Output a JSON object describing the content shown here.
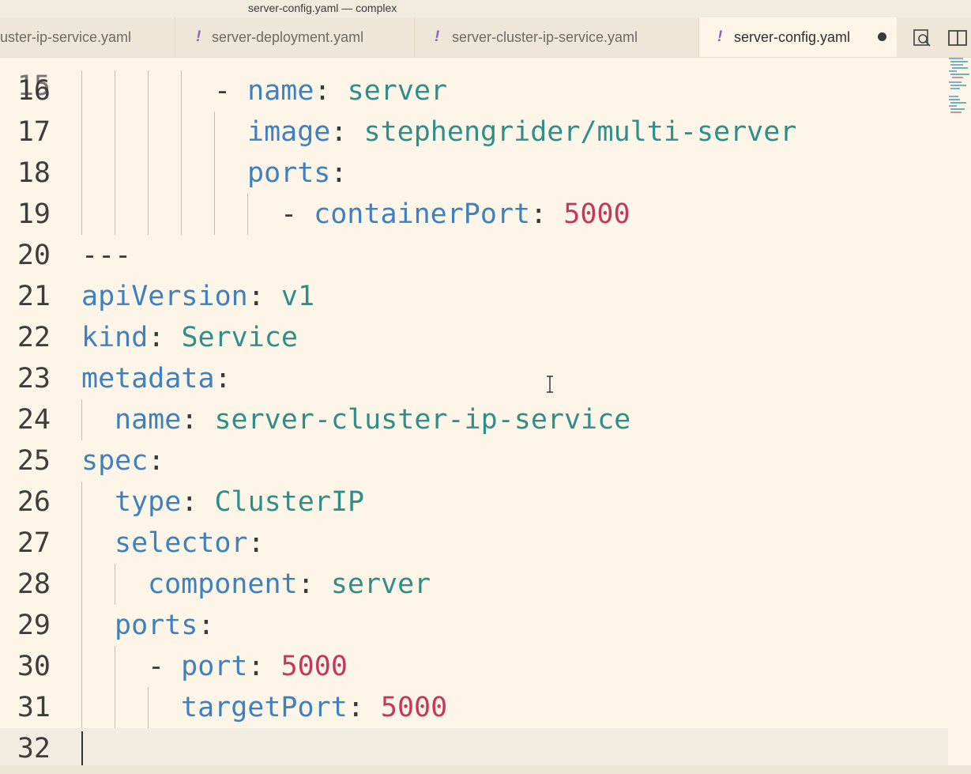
{
  "window": {
    "title": "server-config.yaml — complex"
  },
  "tabs": [
    {
      "label": "uster-ip-service.yaml",
      "excl": "",
      "modified": false,
      "active": false
    },
    {
      "label": "server-deployment.yaml",
      "excl": "!",
      "modified": false,
      "active": false
    },
    {
      "label": "server-cluster-ip-service.yaml",
      "excl": "!",
      "modified": false,
      "active": false
    },
    {
      "label": "server-config.yaml",
      "excl": "!",
      "modified": true,
      "active": true
    }
  ],
  "actions": [
    {
      "icon": "open-changes-icon"
    },
    {
      "icon": "split-editor-icon"
    }
  ],
  "editor": {
    "lines": [
      {
        "num": "16",
        "tokens": [
          {
            "t": "- ",
            "c": "p"
          },
          {
            "t": "name",
            "c": "k"
          },
          {
            "t": ": ",
            "c": "p"
          },
          {
            "t": "server",
            "c": "s"
          }
        ]
      },
      {
        "num": "17",
        "tokens": [
          {
            "t": "image",
            "c": "k"
          },
          {
            "t": ": ",
            "c": "p"
          },
          {
            "t": "stephengrider/multi-server",
            "c": "s"
          }
        ]
      },
      {
        "num": "18",
        "tokens": [
          {
            "t": "ports",
            "c": "k"
          },
          {
            "t": ":",
            "c": "p"
          }
        ]
      },
      {
        "num": "19",
        "tokens": [
          {
            "t": "- ",
            "c": "p"
          },
          {
            "t": "containerPort",
            "c": "k"
          },
          {
            "t": ": ",
            "c": "p"
          },
          {
            "t": "5000",
            "c": "n"
          }
        ]
      },
      {
        "num": "20",
        "tokens": [
          {
            "t": "---",
            "c": "p"
          }
        ]
      },
      {
        "num": "21",
        "tokens": [
          {
            "t": "apiVersion",
            "c": "k"
          },
          {
            "t": ": ",
            "c": "p"
          },
          {
            "t": "v1",
            "c": "s"
          }
        ]
      },
      {
        "num": "22",
        "tokens": [
          {
            "t": "kind",
            "c": "k"
          },
          {
            "t": ": ",
            "c": "p"
          },
          {
            "t": "Service",
            "c": "s"
          }
        ]
      },
      {
        "num": "23",
        "tokens": [
          {
            "t": "metadata",
            "c": "k"
          },
          {
            "t": ":",
            "c": "p"
          }
        ]
      },
      {
        "num": "24",
        "tokens": [
          {
            "t": "name",
            "c": "k"
          },
          {
            "t": ": ",
            "c": "p"
          },
          {
            "t": "server-cluster-ip-service",
            "c": "s"
          }
        ]
      },
      {
        "num": "25",
        "tokens": [
          {
            "t": "spec",
            "c": "k"
          },
          {
            "t": ":",
            "c": "p"
          }
        ]
      },
      {
        "num": "26",
        "tokens": [
          {
            "t": "type",
            "c": "k"
          },
          {
            "t": ": ",
            "c": "p"
          },
          {
            "t": "ClusterIP",
            "c": "s"
          }
        ]
      },
      {
        "num": "27",
        "tokens": [
          {
            "t": "selector",
            "c": "k"
          },
          {
            "t": ":",
            "c": "p"
          }
        ]
      },
      {
        "num": "28",
        "tokens": [
          {
            "t": "component",
            "c": "k"
          },
          {
            "t": ": ",
            "c": "p"
          },
          {
            "t": "server",
            "c": "s"
          }
        ]
      },
      {
        "num": "29",
        "tokens": [
          {
            "t": "ports",
            "c": "k"
          },
          {
            "t": ":",
            "c": "p"
          }
        ]
      },
      {
        "num": "30",
        "tokens": [
          {
            "t": "- ",
            "c": "p"
          },
          {
            "t": "port",
            "c": "k"
          },
          {
            "t": ": ",
            "c": "p"
          },
          {
            "t": "5000",
            "c": "n"
          }
        ]
      },
      {
        "num": "31",
        "tokens": [
          {
            "t": "targetPort",
            "c": "k"
          },
          {
            "t": ": ",
            "c": "p"
          },
          {
            "t": "5000",
            "c": "n"
          }
        ]
      },
      {
        "num": "32",
        "tokens": []
      }
    ],
    "current_line": "32"
  },
  "colors": {
    "key": "#3f80c0",
    "string": "#2f8f88",
    "number": "#c6385b",
    "warning_excl": "#8e5fc8",
    "background": "#fdf6e8"
  }
}
